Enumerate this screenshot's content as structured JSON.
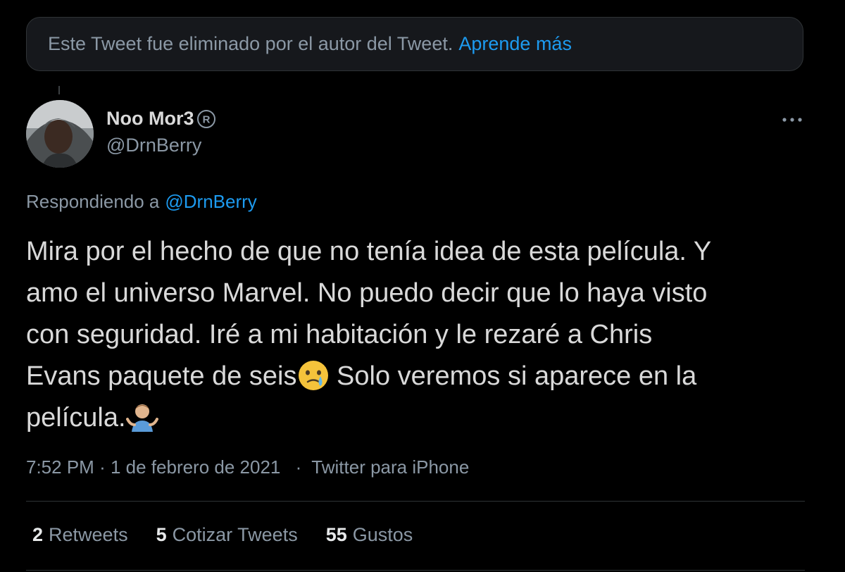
{
  "deleted_notice": {
    "text": "Este Tweet fue eliminado por el autor del Tweet.",
    "link": "Aprende más"
  },
  "author": {
    "name": "Noo Mor3",
    "name_badge": "®",
    "handle": "@DrnBerry"
  },
  "reply": {
    "prefix": "Respondiendo a",
    "mention": "@DrnBerry"
  },
  "tweet": {
    "line1": "Mira por el hecho de que no tenía idea de esta película. Y",
    "line2": "amo el universo Marvel. No puedo decir que lo haya visto",
    "line3": "con seguridad. Iré a mi habitación y le rezaré a Chris",
    "line4_a": "Evans paquete de seis",
    "line4_b": " Solo veremos si aparece en la",
    "line5": "película.",
    "emoji_1": "face-holding-back-tears-emoji",
    "emoji_2": "person-shrugging-emoji"
  },
  "meta": {
    "time": "7:52 PM",
    "dot1": "·",
    "date": "1 de febrero de 2021",
    "dot2": "·",
    "source": "Twitter para iPhone"
  },
  "stats": {
    "retweets_count": "2",
    "retweets_label": "Retweets",
    "quotes_count": "5",
    "quotes_label": "Cotizar Tweets",
    "likes_count": "55",
    "likes_label": "Gustos"
  },
  "colors": {
    "background": "#000000",
    "text": "#d9d9d9",
    "secondary": "#8b98a5",
    "link": "#1d9bf0",
    "border": "#2f3336"
  }
}
